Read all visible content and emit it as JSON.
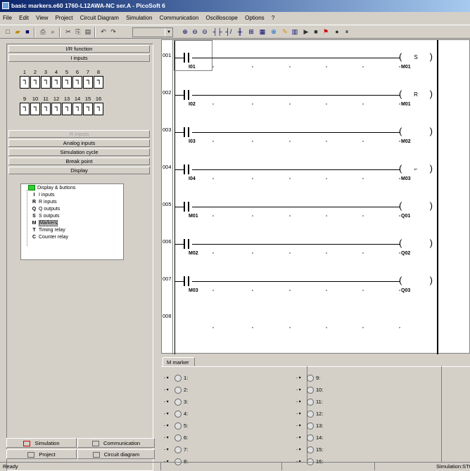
{
  "window": {
    "title": "basic markers.e60 1760-L12AWA-NC ser.A - PicoSoft 6"
  },
  "menu": [
    "File",
    "Edit",
    "View",
    "Project",
    "Circuit Diagram",
    "Simulation",
    "Communication",
    "Oscilloscope",
    "Options",
    "?"
  ],
  "toolbar": {
    "icons": [
      "new-icon",
      "open-icon",
      "save-icon",
      "print-icon",
      "print-preview-icon",
      "cut-icon",
      "copy-icon",
      "paste-icon",
      "undo-icon",
      "redo-icon",
      "zoom-in-icon",
      "zoom-out-icon",
      "zoom-fit-icon",
      "contact-icon",
      "coil-icon",
      "junction-icon",
      "grid-icon",
      "network-icon",
      "marker-icon",
      "table-icon",
      "run-icon",
      "stop-icon",
      "simulation-icon",
      "record-icon",
      "pause-icon"
    ],
    "combo_value": ""
  },
  "left_panel": {
    "buttons": [
      "I/R function",
      "I inputs"
    ],
    "input_numbers_row1": [
      "1",
      "2",
      "3",
      "4",
      "5",
      "6",
      "7",
      "8"
    ],
    "input_numbers_row2": [
      "9",
      "10",
      "11",
      "12",
      "13",
      "14",
      "15",
      "16"
    ],
    "r_inputs_label": "R inputs",
    "analog_inputs_label": "Analog inputs",
    "simulation_cycle_label": "Simulation cycle",
    "break_point_label": "Break point",
    "display_label": "Display",
    "tree": [
      {
        "key": "",
        "label": "Display & buttons"
      },
      {
        "key": "I",
        "label": "I inputs"
      },
      {
        "key": "R",
        "label": "R inputs"
      },
      {
        "key": "Q",
        "label": "Q outputs"
      },
      {
        "key": "S",
        "label": "S outputs"
      },
      {
        "key": "M",
        "label": "Markers"
      },
      {
        "key": "T",
        "label": "Timing relay"
      },
      {
        "key": "C",
        "label": "Counter relay"
      }
    ],
    "tabs": {
      "simulation": "Simulation",
      "communication": "Communication",
      "project": "Project",
      "circuit_diagram": "Circuit diagram"
    }
  },
  "diagram": {
    "rungs": [
      {
        "num": "001",
        "contact": "I01",
        "coil_type": "S",
        "coil": "M01"
      },
      {
        "num": "002",
        "contact": "I02",
        "coil_type": "R",
        "coil": "M01"
      },
      {
        "num": "003",
        "contact": "I03",
        "coil_type": "",
        "coil": "M02"
      },
      {
        "num": "004",
        "contact": "I04",
        "coil_type": "⌐",
        "coil": "M03"
      },
      {
        "num": "005",
        "contact": "M01",
        "coil_type": "",
        "coil": "Q01"
      },
      {
        "num": "006",
        "contact": "M02",
        "coil_type": "",
        "coil": "Q02"
      },
      {
        "num": "007",
        "contact": "M03",
        "coil_type": "",
        "coil": "Q03"
      },
      {
        "num": "008",
        "contact": "",
        "coil_type": "",
        "coil": ""
      }
    ]
  },
  "marker_panel": {
    "tab": "M marker",
    "left": [
      "1:",
      "2:",
      "3:",
      "4:",
      "5:",
      "6:",
      "7:",
      "8:"
    ],
    "right": [
      "9:",
      "10:",
      "11:",
      "12:",
      "13:",
      "14:",
      "15:",
      "16:"
    ]
  },
  "status": {
    "left": "Ready",
    "right": "Simulation:STO"
  }
}
